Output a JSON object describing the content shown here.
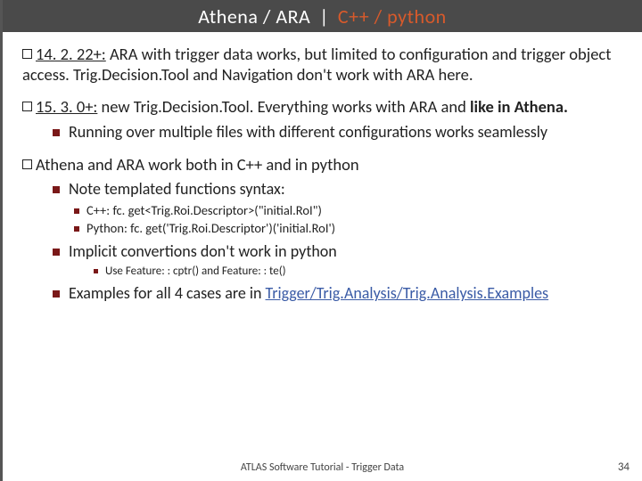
{
  "title": {
    "left": "Athena / ARA",
    "sep": "|",
    "right": "C++ / python"
  },
  "bullets": {
    "b1a_prefix": "14. 2. 22+:",
    "b1a_rest": " ARA with trigger data works, but limited to configuration and trigger object access. Trig.Decision.Tool and Navigation don't work with ARA here.",
    "b1b_prefix": "15. 3. 0+:",
    "b1b_rest_pre": " new Trig.Decision.Tool. Everything works with ARA and ",
    "b1b_bold": "like in Athena.",
    "b2a": "Running over multiple files with different configurations works seamlessly",
    "b1c": "Athena and ARA work both in C++ and in python",
    "b2b": "Note templated functions syntax:",
    "b3a": "C++: fc. get<Trig.Roi.Descriptor>(\"initial.RoI\")",
    "b3b": "Python: fc. get('Trig.Roi.Descriptor')('initial.RoI')",
    "b2c": "Implicit convertions don't work in python",
    "b4a": "Use Feature: : cptr() and Feature: : te()",
    "b2d_pre": "Examples for all 4 cases are in ",
    "b2d_link": "Trigger/Trig.Analysis/Trig.Analysis.Examples"
  },
  "footer": "ATLAS Software Tutorial - Trigger Data",
  "page": "34"
}
